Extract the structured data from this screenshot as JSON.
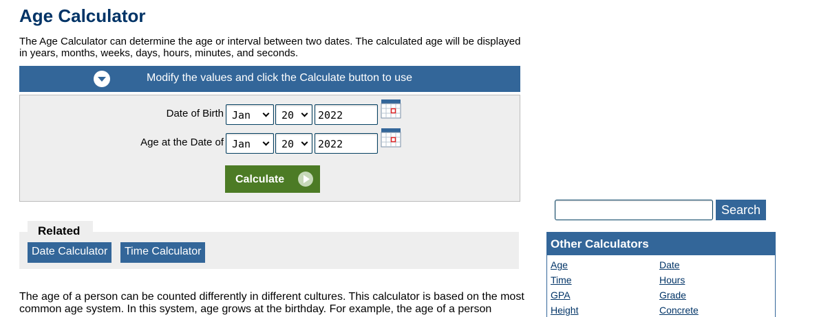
{
  "page": {
    "title": "Age Calculator",
    "intro": "The Age Calculator can determine the age or interval between two dates. The calculated age will be displayed in years, months, weeks, days, hours, minutes, and seconds."
  },
  "banner": {
    "text": "Modify the values and click the Calculate button to use"
  },
  "form": {
    "dob": {
      "label": "Date of Birth",
      "month": "Jan",
      "day": "20",
      "year": "2022"
    },
    "at": {
      "label": "Age at the Date of",
      "month": "Jan",
      "day": "20",
      "year": "2022"
    },
    "calculate_label": "Calculate"
  },
  "related": {
    "heading": "Related",
    "links": [
      "Date Calculator",
      "Time Calculator"
    ]
  },
  "body_text": "The age of a person can be counted differently in different cultures. This calculator is based on the most common age system. In this system, age grows at the birthday. For example, the age of a person",
  "search": {
    "value": "",
    "button_label": "Search"
  },
  "other_calculators": {
    "heading": "Other Calculators",
    "left": [
      "Age",
      "Time",
      "GPA",
      "Height"
    ],
    "right": [
      "Date",
      "Hours",
      "Grade",
      "Concrete"
    ]
  },
  "colors": {
    "accent": "#336699",
    "calculate": "#4c7b25",
    "title": "#003366"
  }
}
